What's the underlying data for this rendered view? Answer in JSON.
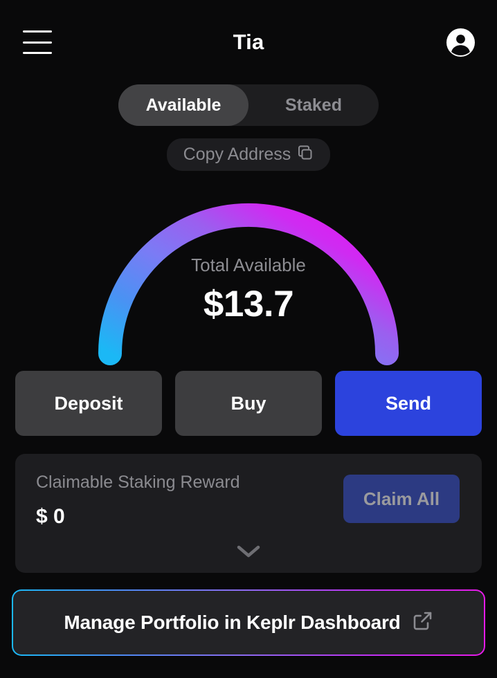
{
  "header": {
    "title": "Tia",
    "menu_icon": "hamburger-menu-icon",
    "avatar_icon": "user-avatar-icon"
  },
  "tabs": [
    {
      "label": "Available",
      "active": true
    },
    {
      "label": "Staked",
      "active": false
    }
  ],
  "copy_address": {
    "label": "Copy Address",
    "icon": "copy-icon"
  },
  "gauge": {
    "label": "Total Available",
    "value": "$13.7",
    "gradient_start": "#1bb8f5",
    "gradient_mid": "#8a6cf0",
    "gradient_end": "#e01af0"
  },
  "actions": [
    {
      "label": "Deposit",
      "style": "secondary"
    },
    {
      "label": "Buy",
      "style": "secondary"
    },
    {
      "label": "Send",
      "style": "primary"
    }
  ],
  "reward": {
    "title": "Claimable Staking Reward",
    "value": "$ 0",
    "claim_label": "Claim All",
    "expand_icon": "chevron-down-icon"
  },
  "dashboard": {
    "label": "Manage Portfolio in Keplr Dashboard",
    "icon": "external-link-icon"
  },
  "colors": {
    "background": "#09090a",
    "card": "#1d1d20",
    "tab_track": "#1e1e20",
    "tab_active": "#434345",
    "secondary_button": "#3d3d3f",
    "primary_button": "#2c43dd",
    "claim_button": "#2c3a82",
    "muted_text": "#8d8d92",
    "accent_cyan": "#1bb8f5",
    "accent_magenta": "#e01af0"
  }
}
